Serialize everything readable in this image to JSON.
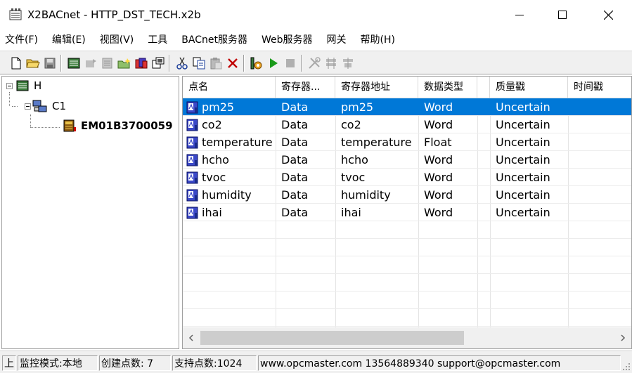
{
  "window": {
    "title": "X2BACnet - HTTP_DST_TECH.x2b"
  },
  "menu": [
    {
      "label": "文件(F)"
    },
    {
      "label": "编辑(E)"
    },
    {
      "label": "视图(V)"
    },
    {
      "label": "工具"
    },
    {
      "label": "BACnet服务器"
    },
    {
      "label": "Web服务器"
    },
    {
      "label": "网关"
    },
    {
      "label": "帮助(H)"
    }
  ],
  "toolbar_icons": [
    "new-file-icon",
    "open-folder-icon",
    "save-icon",
    "server-icon",
    "add-device-icon",
    "device-properties-icon",
    "import-icon",
    "add-group-icon",
    "group-properties-icon",
    "cut-icon",
    "copy-icon",
    "paste-icon",
    "delete-icon",
    "monitor-icon",
    "run-icon",
    "stop-icon",
    "tools-icon",
    "config-icon",
    "config2-icon"
  ],
  "tree": {
    "root": {
      "label": "H"
    },
    "channel": {
      "label": "C1"
    },
    "device": {
      "label": "EM01B3700059"
    }
  },
  "list": {
    "columns": [
      "点名",
      "寄存器...",
      "寄存器地址",
      "数据类型",
      "质量戳",
      "时间戳"
    ],
    "rows": [
      {
        "name": "pm25",
        "register": "Data",
        "address": "pm25",
        "type": "Word",
        "quality": "Uncertain",
        "timestamp": ""
      },
      {
        "name": "co2",
        "register": "Data",
        "address": "co2",
        "type": "Word",
        "quality": "Uncertain",
        "timestamp": ""
      },
      {
        "name": "temperature",
        "register": "Data",
        "address": "temperature",
        "type": "Float",
        "quality": "Uncertain",
        "timestamp": ""
      },
      {
        "name": "hcho",
        "register": "Data",
        "address": "hcho",
        "type": "Word",
        "quality": "Uncertain",
        "timestamp": ""
      },
      {
        "name": "tvoc",
        "register": "Data",
        "address": "tvoc",
        "type": "Word",
        "quality": "Uncertain",
        "timestamp": ""
      },
      {
        "name": "humidity",
        "register": "Data",
        "address": "humidity",
        "type": "Word",
        "quality": "Uncertain",
        "timestamp": ""
      },
      {
        "name": "ihai",
        "register": "Data",
        "address": "ihai",
        "type": "Word",
        "quality": "Uncertain",
        "timestamp": ""
      }
    ],
    "selected_index": 0
  },
  "status": {
    "p1": "上",
    "p2": "监控模式:本地",
    "p3": "创建点数:  7",
    "p4": "支持点数:1024",
    "p5": "www.opcmaster.com 13564889340 support@opcmaster.com"
  },
  "colors": {
    "selection": "#0078d7",
    "toolbar_bg": "#f0f0f0"
  }
}
